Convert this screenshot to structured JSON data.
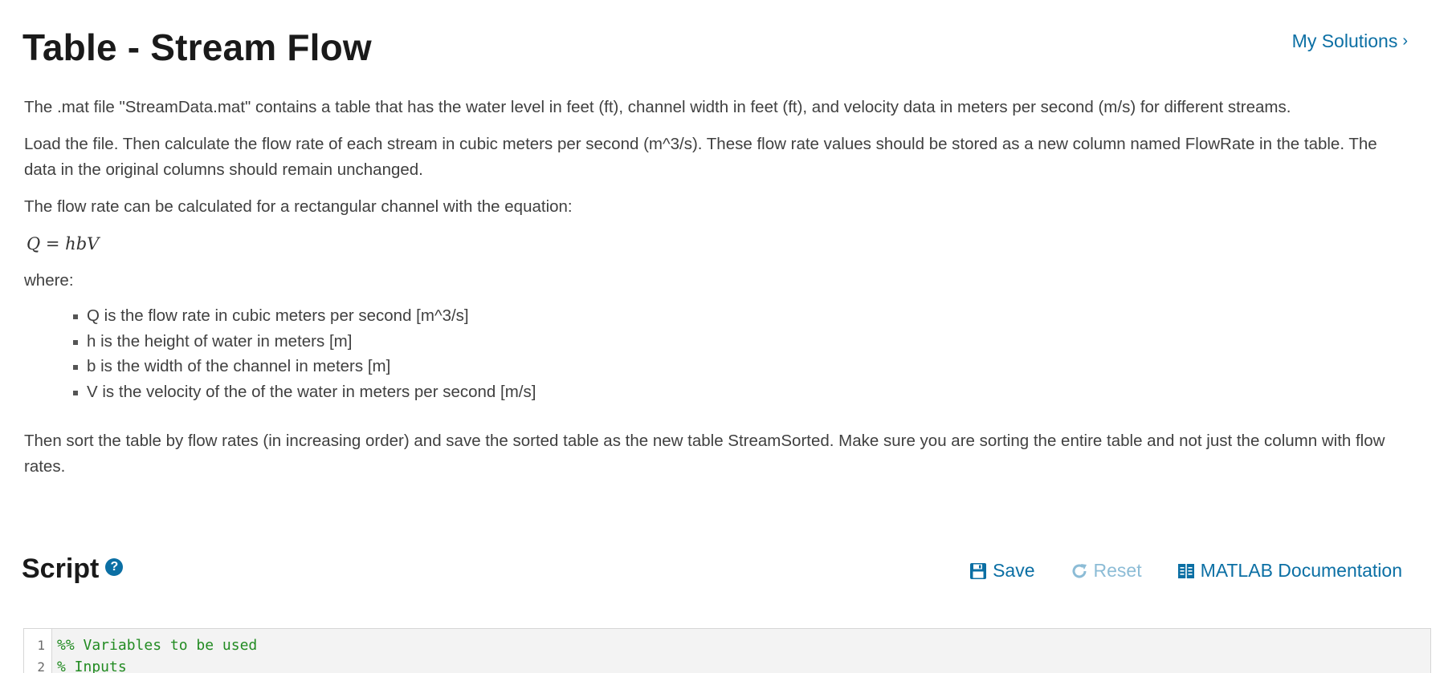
{
  "problem": {
    "title": "Table - Stream Flow",
    "my_solutions_label": "My Solutions",
    "paragraph1": "The .mat file \"StreamData.mat\" contains a table that has the water level in feet (ft), channel width in feet (ft), and velocity data in meters per second (m/s) for different streams.",
    "paragraph2": "Load the file. Then calculate the flow rate of each stream in cubic meters per second (m^3/s). These flow rate values should be stored as a new column named FlowRate in the table. The data in the original columns should remain unchanged.",
    "paragraph3": "The flow rate can be calculated for a rectangular channel with the equation:",
    "equation": "Q = hbV",
    "where_label": "where:",
    "bullets": [
      "Q is the flow rate in cubic meters per second [m^3/s]",
      "h is the height of water in meters [m]",
      "b is the width of the channel in meters [m]",
      "V is the velocity of the of the water in meters per second [m/s]"
    ],
    "paragraph4": "Then sort the table by flow rates (in increasing order) and save the sorted table as the new table StreamSorted. Make sure you are sorting the entire table and not just the column with flow rates."
  },
  "script": {
    "heading": "Script",
    "help_icon": "question-circle-icon",
    "toolbar": {
      "save_label": "Save",
      "reset_label": "Reset",
      "docs_label": "MATLAB Documentation"
    },
    "lines": [
      {
        "number": "1",
        "code": "%% Variables to be used"
      },
      {
        "number": "2",
        "code": "% Inputs"
      }
    ]
  },
  "colors": {
    "link": "#0b6fa4",
    "link_disabled": "#8cbcd6",
    "comment": "#228b22"
  }
}
